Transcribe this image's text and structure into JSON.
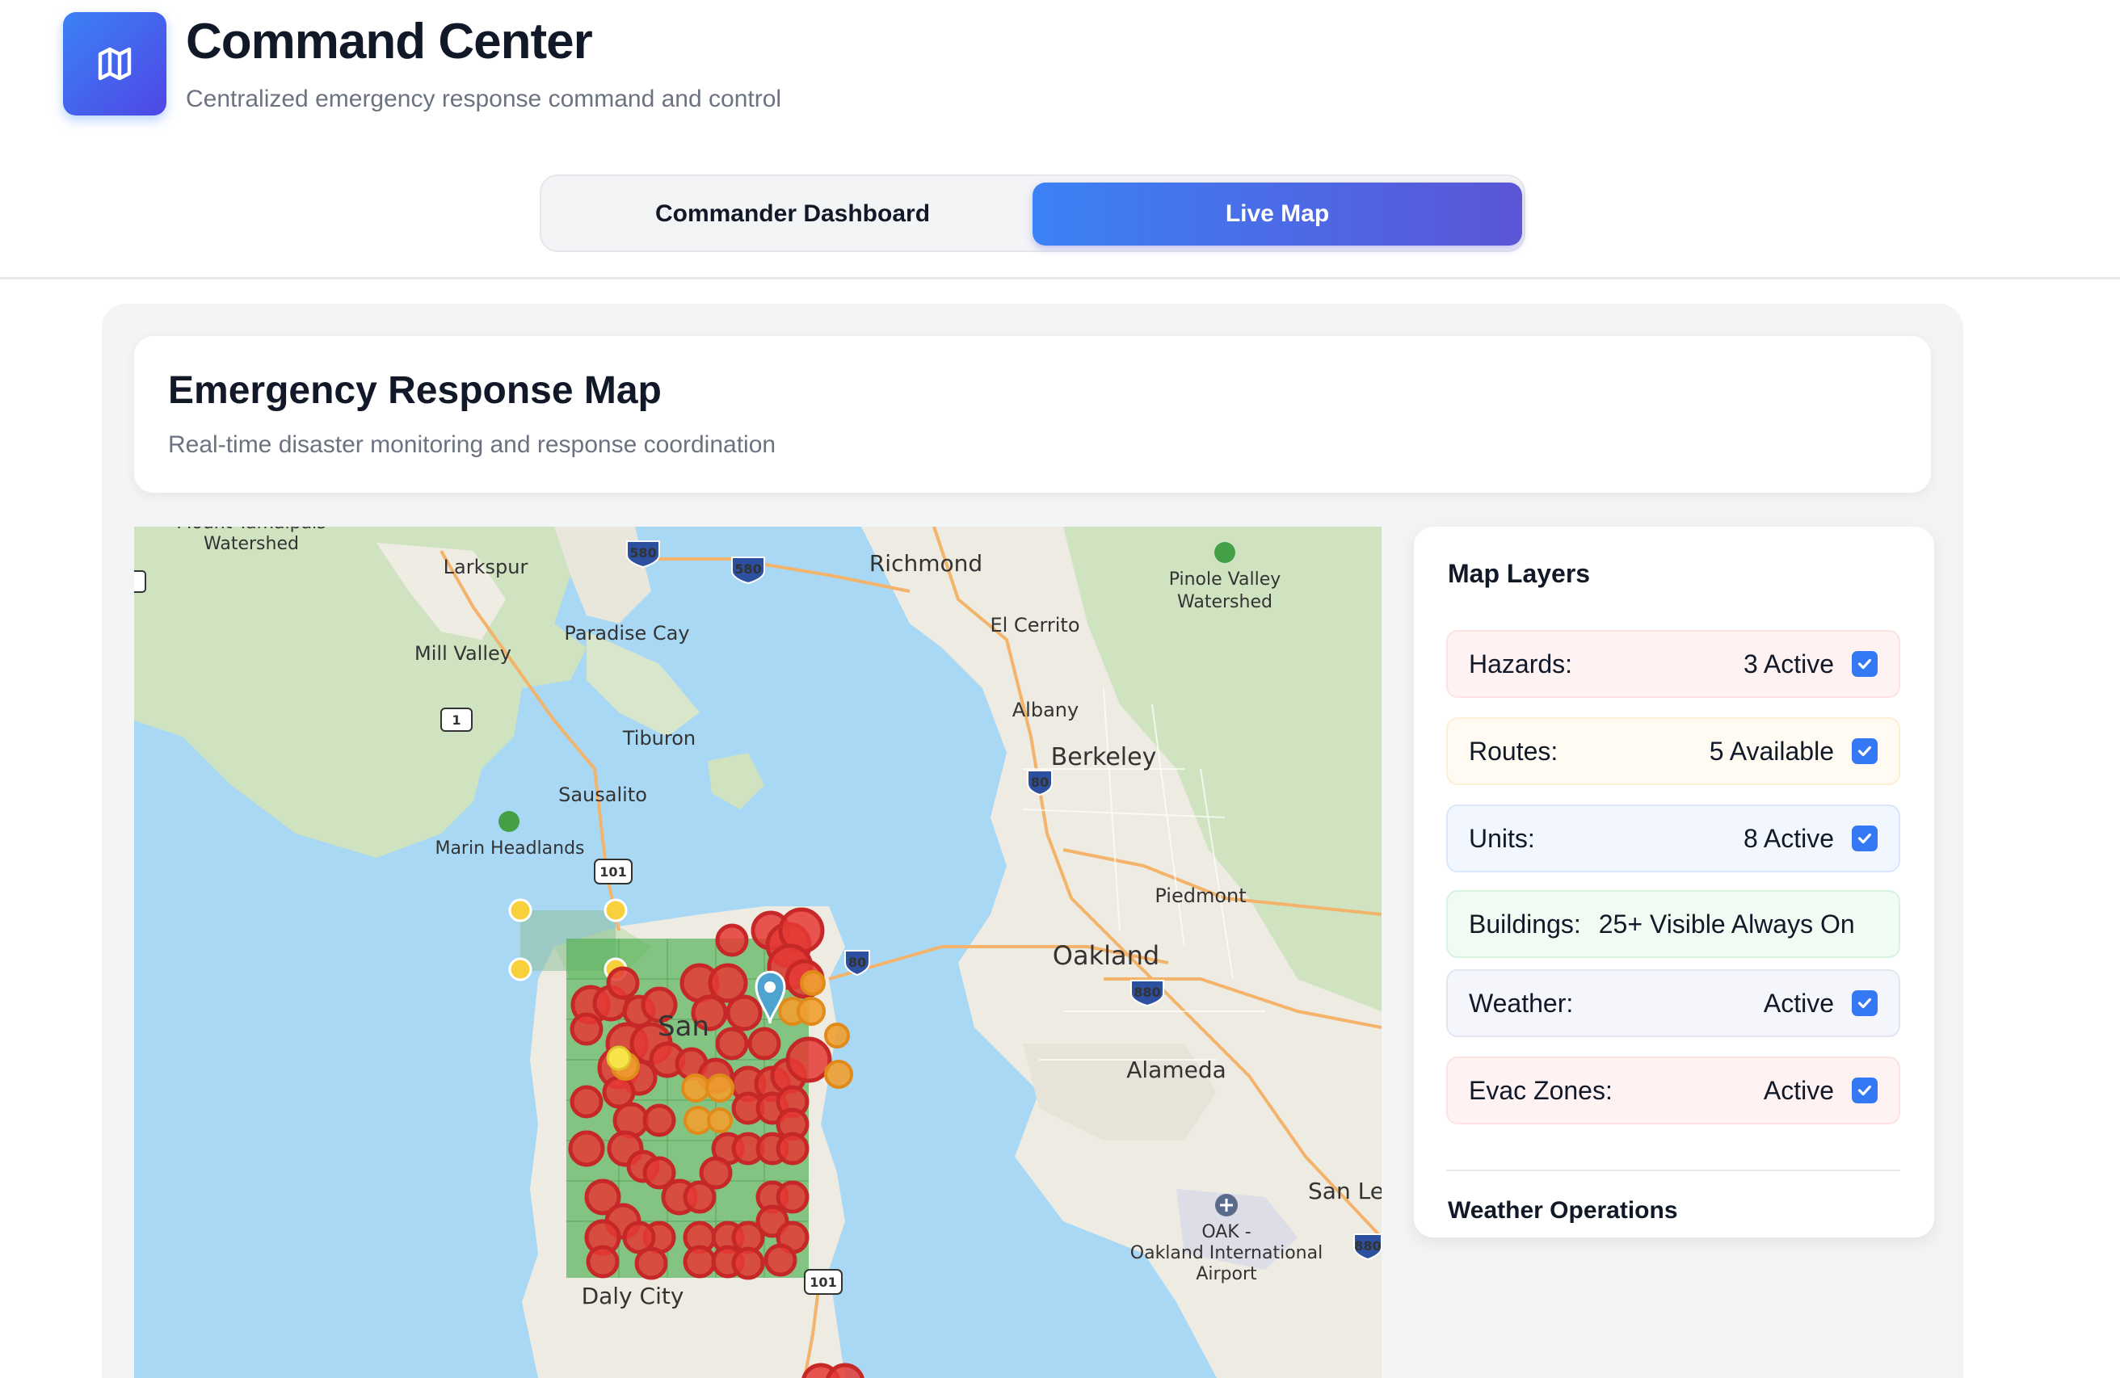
{
  "header": {
    "title": "Command Center",
    "subtitle": "Centralized emergency response command and control",
    "logo_icon": "map-icon"
  },
  "tabs": [
    {
      "label": "Commander Dashboard",
      "active": false
    },
    {
      "label": "Live Map",
      "active": true
    }
  ],
  "map_card": {
    "title": "Emergency Response Map",
    "subtitle": "Real-time disaster monitoring and response coordination"
  },
  "map": {
    "place_labels": {
      "mount_tamalpais": "Mount Tamalpais",
      "watershed_1": "Watershed",
      "larkspur": "Larkspur",
      "richmond": "Richmond",
      "pinole_valley": "Pinole Valley",
      "watershed_2": "Watershed",
      "el_cerrito": "El Cerrito",
      "paradise_cay": "Paradise Cay",
      "mill_valley": "Mill Valley",
      "albany": "Albany",
      "tiburon": "Tiburon",
      "berkeley": "Berkeley",
      "sausalito": "Sausalito",
      "marin_headlands": "Marin Headlands",
      "piedmont": "Piedmont",
      "oakland": "Oakland",
      "alameda": "Alameda",
      "san_leandro": "San Le",
      "oak": "OAK -",
      "oak_airport_1": "Oakland International",
      "oak_airport_2": "Airport",
      "daly_city": "Daly City",
      "san_francisco": "San"
    },
    "shields": {
      "i580_a": "580",
      "i580_b": "580",
      "i80_a": "80",
      "i80_b": "80",
      "i880_a": "880",
      "i880_b": "880",
      "us101_a": "101",
      "us101_b": "101",
      "ca1": "1"
    },
    "colors": {
      "water": "#a9d8f5",
      "land": "#f1efe8",
      "green": "#cfe3c1",
      "hazard_red": "#e53935",
      "hazard_orange": "#f0a030",
      "evac_zone": "#4caf50",
      "marker": "#4fa3d1"
    }
  },
  "layers": {
    "title": "Map Layers",
    "rows": [
      {
        "label": "Hazards:",
        "value": "3 Active",
        "checked": true
      },
      {
        "label": "Routes:",
        "value": "5 Available",
        "checked": true
      },
      {
        "label": "Units:",
        "value": "8 Active",
        "checked": true
      },
      {
        "label": "Buildings:",
        "value": "25+ Visible Always On",
        "checked": null
      },
      {
        "label": "Weather:",
        "value": "Active",
        "checked": true
      },
      {
        "label": "Evac Zones:",
        "value": "Active",
        "checked": true
      }
    ],
    "weather_ops_title": "Weather Operations"
  }
}
